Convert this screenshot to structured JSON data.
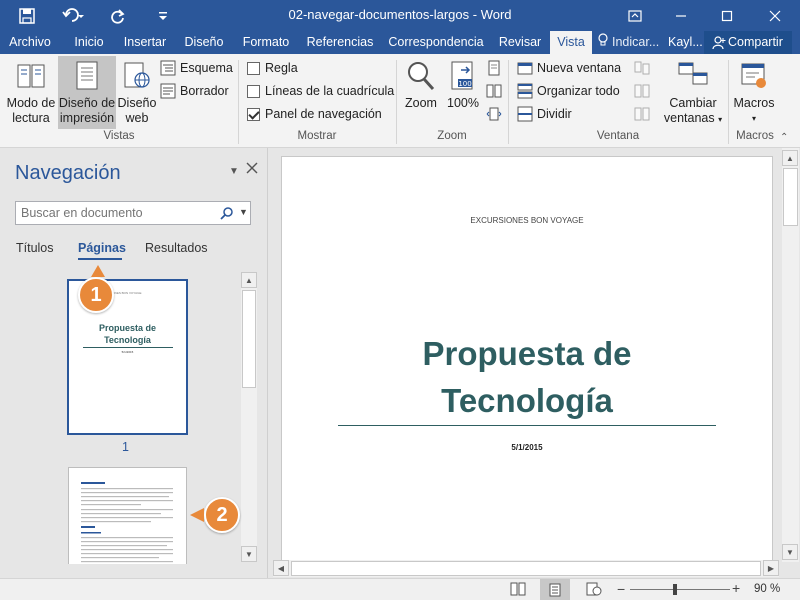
{
  "window": {
    "title": "02-navegar-documentos-largos  -  Word"
  },
  "tabs": [
    {
      "label": "Archivo"
    },
    {
      "label": "Inicio"
    },
    {
      "label": "Insertar"
    },
    {
      "label": "Diseño"
    },
    {
      "label": "Formato"
    },
    {
      "label": "Referencias"
    },
    {
      "label": "Correspondencia"
    },
    {
      "label": "Revisar"
    },
    {
      "label": "Vista"
    }
  ],
  "tellme": "Indicar...",
  "user": "Kayl...",
  "share": "Compartir",
  "ribbon": {
    "vistas": {
      "modo_lectura": [
        "Modo de",
        "lectura"
      ],
      "diseno_impresion": [
        "Diseño de",
        "impresión"
      ],
      "diseno_web": [
        "Diseño",
        "web"
      ],
      "esquema": "Esquema",
      "borrador": "Borrador",
      "label": "Vistas"
    },
    "mostrar": {
      "regla": "Regla",
      "lineas": "Líneas de la cuadrícula",
      "panel": "Panel de navegación",
      "label": "Mostrar"
    },
    "zoom": {
      "zoom": "Zoom",
      "cien": "100%",
      "label": "Zoom"
    },
    "ventana": {
      "nueva": "Nueva ventana",
      "organizar": "Organizar todo",
      "dividir": "Dividir",
      "cambiar": [
        "Cambiar",
        "ventanas"
      ],
      "label": "Ventana"
    },
    "macros": {
      "macros": "Macros",
      "label": "Macros"
    }
  },
  "nav": {
    "title": "Navegación",
    "search_placeholder": "Buscar en documento",
    "tabs": [
      "Títulos",
      "Páginas",
      "Resultados"
    ],
    "page1_number": "1",
    "thumb1_header": "EXCURSIONES BON VOYAGE",
    "thumb1_title": [
      "Propuesta de",
      "Tecnología"
    ],
    "thumb1_date": "5/1/2015"
  },
  "callouts": [
    "1",
    "2"
  ],
  "document": {
    "header": "EXCURSIONES BON VOYAGE",
    "title_line1": "Propuesta de",
    "title_line2": "Tecnología",
    "date": "5/1/2015"
  },
  "status": {
    "zoom": "90 %"
  },
  "colors": {
    "brand": "#2b579a",
    "title_teal": "#2e5e61",
    "callout": "#e8893a"
  }
}
